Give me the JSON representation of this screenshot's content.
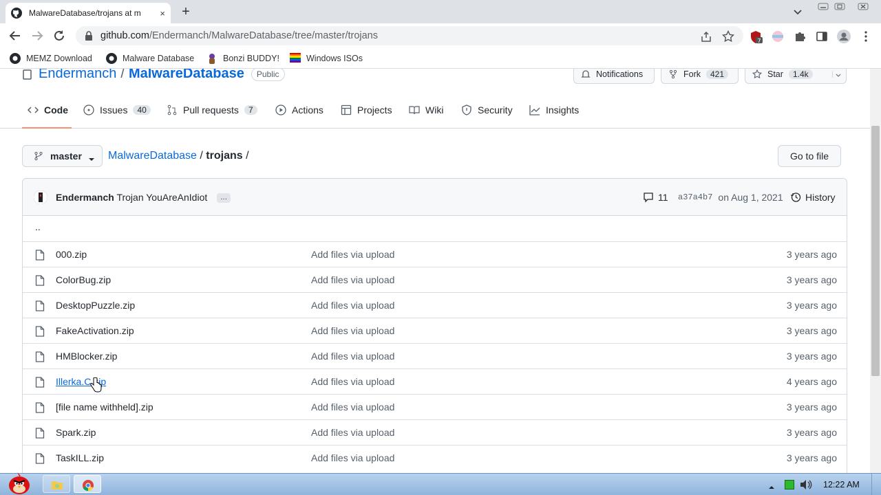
{
  "browser": {
    "tab_title": "MalwareDatabase/trojans at m",
    "tab_close": "×",
    "new_tab": "+",
    "url_host": "github.com",
    "url_path": "/Endermanch/MalwareDatabase/tree/master/trojans",
    "extension_badge": "7",
    "bookmarks": [
      {
        "label": "MEMZ Download",
        "icon": "github-icon"
      },
      {
        "label": "Malware Database",
        "icon": "github-icon"
      },
      {
        "label": "Bonzi BUDDY!",
        "icon": "bonzi-icon"
      },
      {
        "label": "Windows ISOs",
        "icon": "rainbow-flag-icon"
      }
    ]
  },
  "repo": {
    "owner": "Endermanch",
    "separator": "/",
    "name": "MalwareDatabase",
    "visibility": "Public",
    "notifications_label": "Notifications",
    "fork_label": "Fork",
    "fork_count": "421",
    "star_label": "Star",
    "star_count": "1.4k"
  },
  "nav": [
    {
      "label": "Code",
      "count": ""
    },
    {
      "label": "Issues",
      "count": "40"
    },
    {
      "label": "Pull requests",
      "count": "7"
    },
    {
      "label": "Actions",
      "count": ""
    },
    {
      "label": "Projects",
      "count": ""
    },
    {
      "label": "Wiki",
      "count": ""
    },
    {
      "label": "Security",
      "count": ""
    },
    {
      "label": "Insights",
      "count": ""
    }
  ],
  "branch": "master",
  "breadcrumb": {
    "repo": "MalwareDatabase",
    "sep1": " / ",
    "dir": "trojans",
    "sep2": " /"
  },
  "go_to_file": "Go to file",
  "commit": {
    "author": "Endermanch",
    "message": "Trojan YouAreAnIdiot",
    "ellipsis": "…",
    "comments": "11",
    "sha": "a37a4b7",
    "date": "on Aug 1, 2021",
    "history": "History"
  },
  "parent_dir": "..",
  "files": [
    {
      "name": "000.zip",
      "message": "Add files via upload",
      "age": "3 years ago"
    },
    {
      "name": "ColorBug.zip",
      "message": "Add files via upload",
      "age": "3 years ago"
    },
    {
      "name": "DesktopPuzzle.zip",
      "message": "Add files via upload",
      "age": "3 years ago"
    },
    {
      "name": "FakeActivation.zip",
      "message": "Add files via upload",
      "age": "3 years ago"
    },
    {
      "name": "HMBlocker.zip",
      "message": "Add files via upload",
      "age": "3 years ago"
    },
    {
      "name": "Illerka.C.zip",
      "message": "Add files via upload",
      "age": "4 years ago"
    },
    {
      "name": "[file name withheld].zip",
      "message": "Add files via upload",
      "age": "3 years ago"
    },
    {
      "name": "Spark.zip",
      "message": "Add files via upload",
      "age": "3 years ago"
    },
    {
      "name": "TaskILL.zip",
      "message": "Add files via upload",
      "age": "3 years ago"
    }
  ],
  "taskbar": {
    "clock": "12:22 AM"
  },
  "colors": {
    "link": "#0969da",
    "nav_underline": "#fd8c73"
  }
}
